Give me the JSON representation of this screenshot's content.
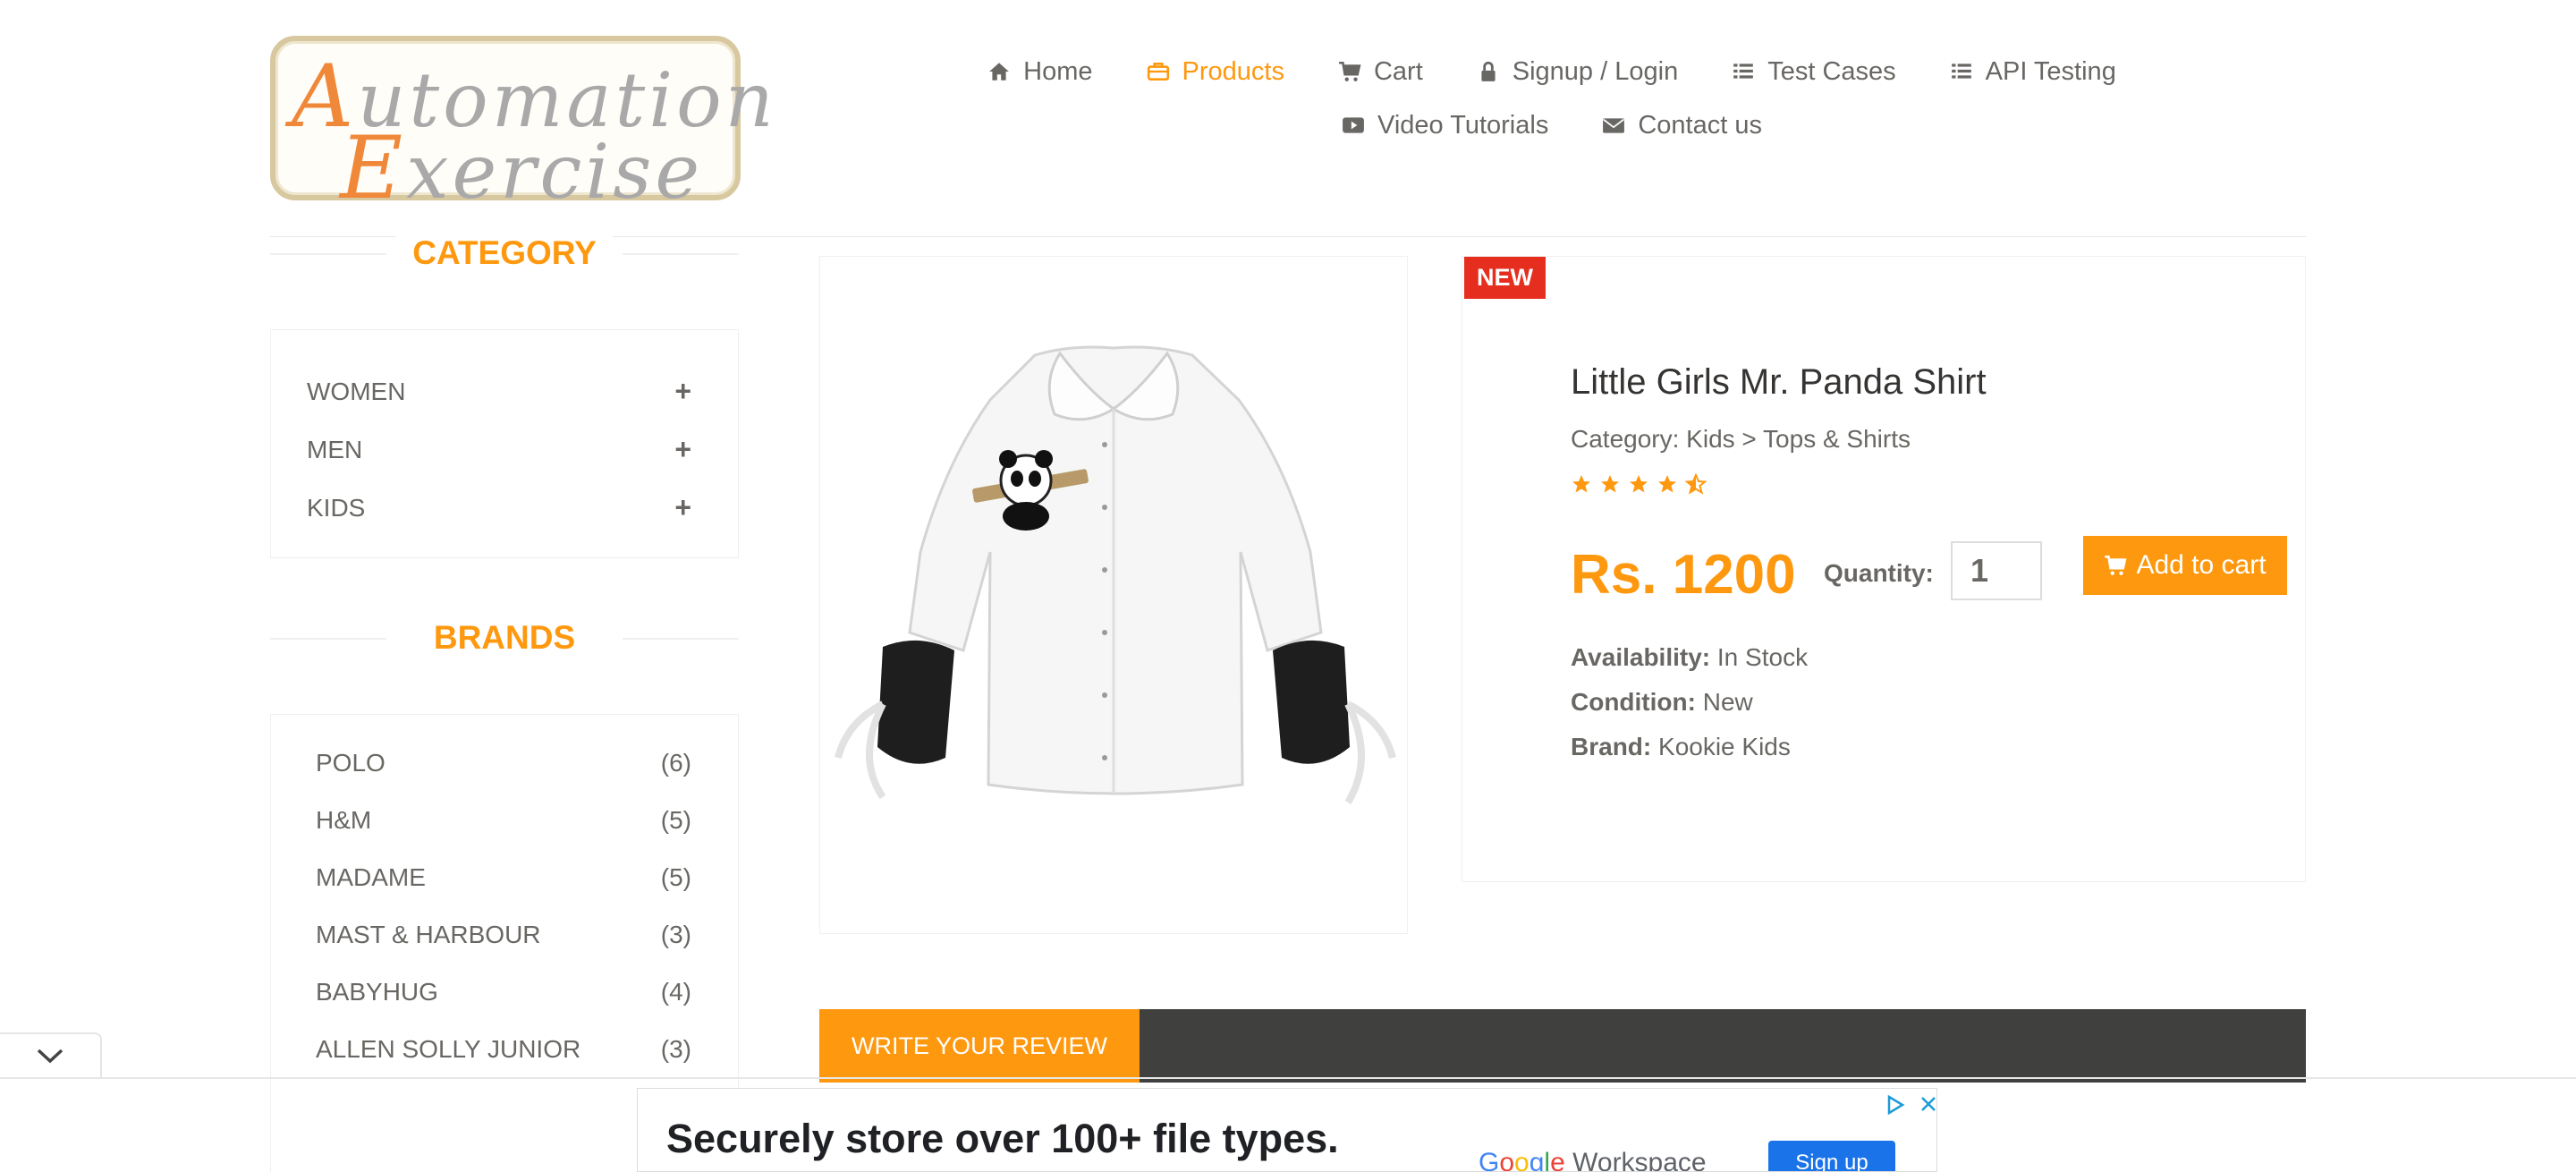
{
  "brand": {
    "logo_line1_initial": "A",
    "logo_line1_rest": "utomation",
    "logo_line2_initial": "E",
    "logo_line2_rest": "xercise"
  },
  "nav": {
    "items": [
      {
        "label": "Home",
        "icon": "home-icon"
      },
      {
        "label": "Products",
        "icon": "briefcase-icon",
        "active": true
      },
      {
        "label": "Cart",
        "icon": "cart-icon"
      },
      {
        "label": "Signup / Login",
        "icon": "lock-icon"
      },
      {
        "label": "Test Cases",
        "icon": "list-icon"
      },
      {
        "label": "API Testing",
        "icon": "list-icon"
      },
      {
        "label": "Video Tutorials",
        "icon": "youtube-icon"
      },
      {
        "label": "Contact us",
        "icon": "envelope-icon"
      }
    ]
  },
  "sidebar": {
    "category_title": "CATEGORY",
    "categories": [
      "WOMEN",
      "MEN",
      "KIDS"
    ],
    "brands_title": "BRANDS",
    "brands": [
      {
        "name": "POLO",
        "count": "(6)"
      },
      {
        "name": "H&M",
        "count": "(5)"
      },
      {
        "name": "MADAME",
        "count": "(5)"
      },
      {
        "name": "MAST & HARBOUR",
        "count": "(3)"
      },
      {
        "name": "BABYHUG",
        "count": "(4)"
      },
      {
        "name": "ALLEN SOLLY JUNIOR",
        "count": "(3)"
      }
    ]
  },
  "product": {
    "badge": "NEW",
    "name": "Little Girls Mr. Panda Shirt",
    "category": "Category: Kids > Tops & Shirts",
    "rating": 4.5,
    "price": "Rs. 1200",
    "quantity_label": "Quantity:",
    "quantity_value": "1",
    "add_to_cart": "Add to cart",
    "availability_label": "Availability:",
    "availability_value": "In Stock",
    "condition_label": "Condition:",
    "condition_value": "New",
    "brand_label": "Brand:",
    "brand_value": "Kookie Kids"
  },
  "review": {
    "tab_label": "WRITE YOUR REVIEW"
  },
  "ad": {
    "headline": "Securely store over 100+ file types.",
    "brand_google": [
      "G",
      "o",
      "o",
      "g",
      "l",
      "e"
    ],
    "brand_product": "Workspace",
    "cta": "Sign up"
  },
  "colors": {
    "accent": "#FE980F",
    "badge": "#e62e1e",
    "text": "#696763",
    "dark_bar": "#40403e"
  }
}
